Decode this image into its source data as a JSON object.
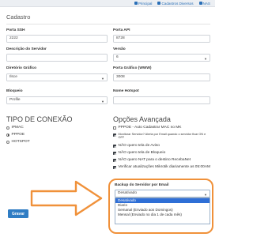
{
  "breadcrumb": {
    "items": [
      {
        "label": "Principal",
        "icon": "home-icon"
      },
      {
        "label": "Cadastros Diversos",
        "icon": "folder-icon"
      },
      {
        "label": "NAS",
        "icon": "server-icon"
      }
    ]
  },
  "panel": {
    "title": "Cadastro"
  },
  "fields": {
    "porta_ssh": {
      "label": "Porta SSH",
      "value": "2222"
    },
    "porta_api": {
      "label": "Porta API",
      "value": "8728"
    },
    "descricao": {
      "label": "Descrição do Servidor",
      "value": ""
    },
    "versao": {
      "label": "Versão",
      "value": "6"
    },
    "diretorio": {
      "label": "Diretório Gráfico",
      "value": "Ilsce"
    },
    "porta_grafico": {
      "label": "Porta Gráfico (WWW)",
      "value": "3008"
    },
    "bloqueio": {
      "label": "Bloqueio",
      "value": "Profile"
    },
    "nome_hotspot": {
      "label": "Nome Hotspot",
      "value": ""
    }
  },
  "tipo_conexao": {
    "title": "TIPO DE CONEXÃO",
    "options": [
      {
        "label": "IPMAC",
        "checked": false
      },
      {
        "label": "PPPOE",
        "checked": true
      },
      {
        "label": "HOTSPOT",
        "checked": false
      }
    ]
  },
  "opcoes": {
    "title": "Opções Avançada",
    "items": [
      {
        "text": "PPPOE - Auto Cadastrar MAC no MK",
        "checked": false
      },
      {
        "text": "Monitorar Servidor? Alerta por Email quando o servidor ficar ON e OFF",
        "checked": true
      },
      {
        "text": "NÃO quero tela de Aviso",
        "checked": true
      },
      {
        "text": "NÃO quero tela de Bloqueio",
        "checked": true
      },
      {
        "text": "NÃO quero NAT para o destino RecebaNet",
        "checked": true
      },
      {
        "text": "Verificar atualizações Mikrotik diariamente as 05:00AM",
        "checked": true
      }
    ]
  },
  "backup": {
    "label": "Backup do Servidor por Email",
    "selected": "Desativado",
    "options": [
      "Desativado",
      "Diario",
      "Semanal (Enviado aos Domingos)",
      "Mensal (Enviado no dia 1 de cada mês)"
    ]
  },
  "save_button": "Gravar",
  "colors": {
    "accent": "#2f7dc4",
    "highlight": "#f0913a",
    "selection": "#2f6fd6"
  }
}
